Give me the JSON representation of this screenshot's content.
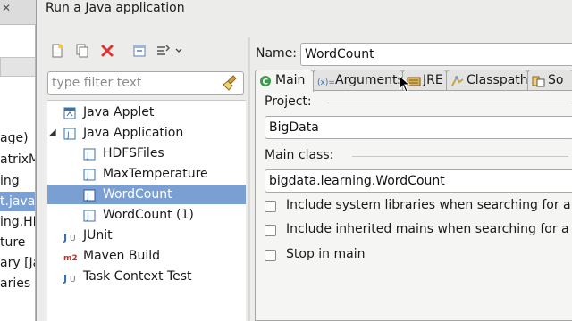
{
  "background": {
    "rows": [
      {
        "text": "age)",
        "selected": false
      },
      {
        "text": "atrixM",
        "selected": false
      },
      {
        "text": "ing",
        "selected": false
      },
      {
        "text": "t.java",
        "selected": true
      },
      {
        "text": "ing.HI",
        "selected": false
      },
      {
        "text": "ture",
        "selected": false
      },
      {
        "text": "ary [Ja",
        "selected": false
      },
      {
        "text": "aries",
        "selected": false
      }
    ]
  },
  "dialog": {
    "title": "Run a Java application",
    "filter": {
      "placeholder": "type filter text"
    },
    "tree": [
      {
        "label": "Java Applet",
        "icon": "java-applet-icon",
        "level": 0,
        "expanded": null,
        "selected": false
      },
      {
        "label": "Java Application",
        "icon": "java-application-icon",
        "level": 0,
        "expanded": true,
        "selected": false
      },
      {
        "label": "HDFSFiles",
        "icon": "java-config-icon",
        "level": 1,
        "selected": false
      },
      {
        "label": "MaxTemperature",
        "icon": "java-config-icon",
        "level": 1,
        "selected": false
      },
      {
        "label": "WordCount",
        "icon": "java-config-icon",
        "level": 1,
        "selected": true
      },
      {
        "label": "WordCount (1)",
        "icon": "java-config-icon",
        "level": 1,
        "selected": false
      },
      {
        "label": "JUnit",
        "icon": "junit-icon",
        "level": 0,
        "selected": false
      },
      {
        "label": "Maven Build",
        "icon": "maven-icon",
        "level": 0,
        "selected": false
      },
      {
        "label": "Task Context Test",
        "icon": "task-context-icon",
        "level": 0,
        "selected": false
      }
    ],
    "name_label": "Name:",
    "name_value": "WordCount",
    "tabs": [
      {
        "label": "Main",
        "icon": "main-tab-icon",
        "active": true
      },
      {
        "label": "Arguments",
        "icon": "arguments-tab-icon",
        "active": false
      },
      {
        "label": "JRE",
        "icon": "jre-tab-icon",
        "active": false
      },
      {
        "label": "Classpath",
        "icon": "classpath-tab-icon",
        "active": false
      },
      {
        "label": "So",
        "icon": "source-tab-icon",
        "active": false
      }
    ],
    "main": {
      "project_label": "Project:",
      "project_value": "BigData",
      "main_class_label": "Main class:",
      "main_class_value": "bigdata.learning.WordCount",
      "checkboxes": [
        {
          "label": "Include system libraries when searching for a ma",
          "checked": false
        },
        {
          "label": "Include inherited mains when searching for a ma",
          "checked": false
        },
        {
          "label": "Stop in main",
          "checked": false
        }
      ]
    }
  },
  "colors": {
    "selection": "#7a9fd3",
    "accent_red": "#d33",
    "java_blue": "#3a6fb0"
  }
}
